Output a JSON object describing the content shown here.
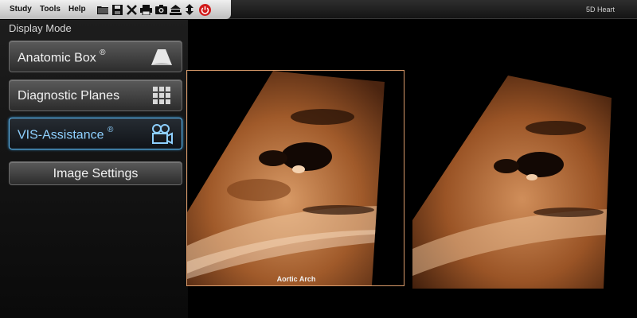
{
  "menu": {
    "study": "Study",
    "tools": "Tools",
    "help": "Help"
  },
  "toolbar_icons": [
    "folder-icon",
    "save-icon",
    "close-icon",
    "print-icon",
    "camera-icon",
    "network-icon",
    "transfer-icon",
    "power-icon"
  ],
  "app_title": "5D Heart",
  "left_panel": {
    "title": "Display Mode",
    "buttons": [
      {
        "label": "Anatomic Box",
        "mark": "®",
        "icon": "probe-icon"
      },
      {
        "label": "Diagnostic Planes",
        "icon": "grid-icon"
      },
      {
        "label": "VIS-Assistance",
        "mark": "®",
        "icon": "video-camera-icon",
        "active": true
      },
      {
        "label": "Image Settings"
      }
    ]
  },
  "viewport": {
    "caption": "Aortic Arch"
  },
  "colors": {
    "accent": "#5fb8f0",
    "frame": "#d89a6a",
    "ultrasound": "#c87a45"
  }
}
